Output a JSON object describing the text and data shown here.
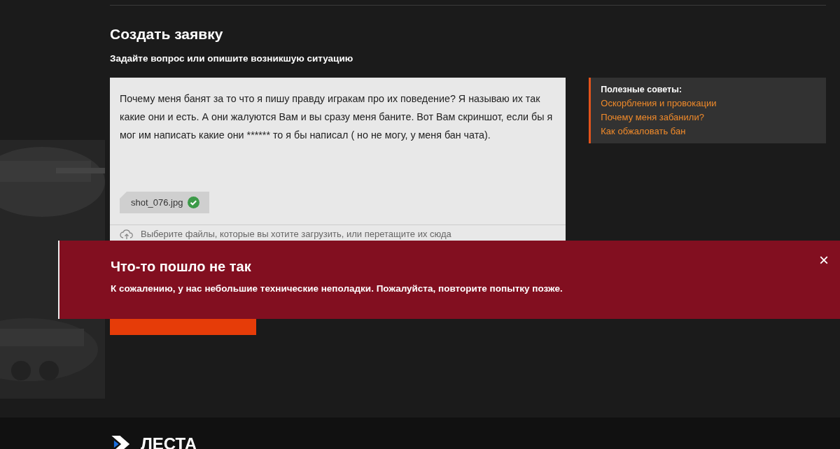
{
  "form": {
    "title": "Создать заявку",
    "subtitle": "Задайте вопрос или опишите возникшую ситуацию",
    "message": "Почему меня банят за то что я пишу правду игракам про их поведение? Я называю их так какие они и есть. А они жалуются Вам и вы сразу меня баните. Вот Вам скриншот, если бы я мог им написать какие они ****** то я бы написал ( но не могу, у меня бан чата).",
    "attachments": [
      {
        "name": "shot_076.jpg",
        "uploaded": true
      }
    ],
    "upload_hint": "Выберите файлы, которые вы хотите загрузить, или перетащите их сюда"
  },
  "tips": {
    "title": "Полезные советы:",
    "links": [
      "Оскорбления и провокации",
      "Почему меня забанили?",
      "Как обжаловать бан"
    ]
  },
  "error_banner": {
    "title": "Что-то пошло не так",
    "message": "К сожалению, у нас небольшие технические неполадки. Пожалуйста, повторите попытку позже.",
    "close": "×"
  },
  "footer": {
    "logo": "ЛЕСТА"
  }
}
